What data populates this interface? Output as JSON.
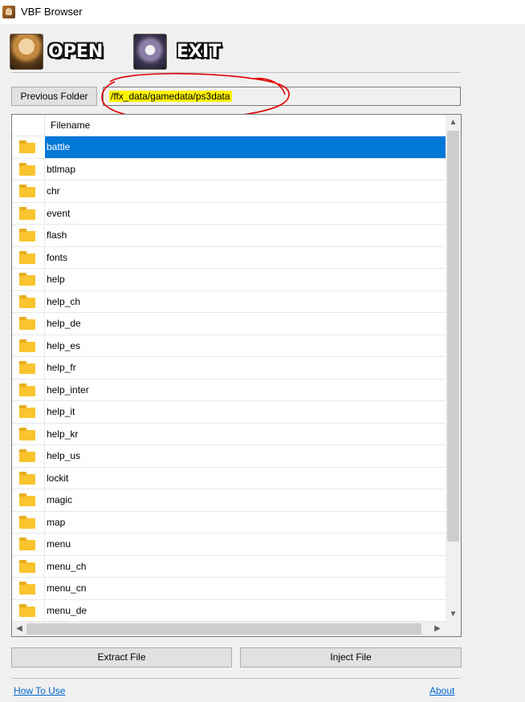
{
  "window": {
    "title": "VBF Browser",
    "icon": "vbf-app-icon"
  },
  "toolbar": {
    "open_label": "OPEN",
    "exit_label": "EXIT",
    "open_icon": "character-portrait-icon",
    "exit_icon": "character-portrait-icon"
  },
  "navigation": {
    "previous_folder_label": "Previous Folder",
    "current_path": "/ffx_data/gamedata/ps3data",
    "path_highlight_color": "#fff200",
    "annotation_color": "#e00000"
  },
  "file_list": {
    "column_header": "Filename",
    "selection_color": "#0078d7",
    "item_icon": "folder-icon",
    "items": [
      {
        "name": "battle",
        "selected": true
      },
      {
        "name": "btlmap"
      },
      {
        "name": "chr"
      },
      {
        "name": "event"
      },
      {
        "name": "flash"
      },
      {
        "name": "fonts"
      },
      {
        "name": "help"
      },
      {
        "name": "help_ch"
      },
      {
        "name": "help_de"
      },
      {
        "name": "help_es"
      },
      {
        "name": "help_fr"
      },
      {
        "name": "help_inter"
      },
      {
        "name": "help_it"
      },
      {
        "name": "help_kr"
      },
      {
        "name": "help_us"
      },
      {
        "name": "lockit"
      },
      {
        "name": "magic"
      },
      {
        "name": "map"
      },
      {
        "name": "menu"
      },
      {
        "name": "menu_ch"
      },
      {
        "name": "menu_cn"
      },
      {
        "name": "menu_de"
      }
    ]
  },
  "actions": {
    "extract_label": "Extract File",
    "inject_label": "Inject File"
  },
  "footer": {
    "how_to_use_label": "How To Use",
    "about_label": "About"
  }
}
